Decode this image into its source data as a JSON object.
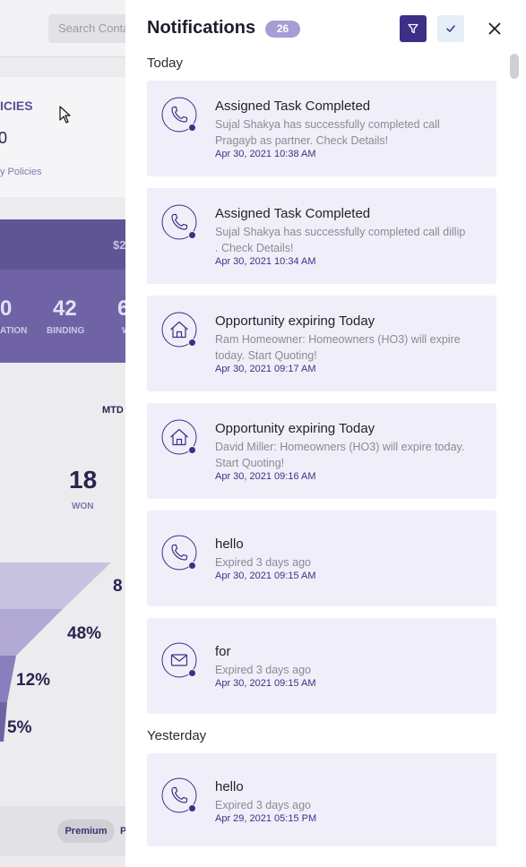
{
  "background": {
    "search_placeholder": "Search Conta",
    "policies_title": "ICIES",
    "policies_value": "0",
    "policies_link": "y Policies",
    "amount": "$2",
    "stats": [
      {
        "value": "0",
        "label": "ATION"
      },
      {
        "value": "42",
        "label": "BINDING"
      },
      {
        "value": "6",
        "label": "W"
      }
    ],
    "mtd_label": "MTD",
    "won_value": "18",
    "won_label": "WON",
    "funnel_percents": [
      "8",
      "48%",
      "12%",
      "5%"
    ],
    "pill_label": "Premium",
    "pill2_label": "P"
  },
  "panel": {
    "title": "Notifications",
    "count": "26",
    "sections": {
      "today": "Today",
      "yesterday": "Yesterday"
    },
    "notifications": [
      {
        "icon": "phone-icon",
        "title": "Assigned Task Completed",
        "desc": "Sujal Shakya has successfully completed call Pragayb as partner. Check Details!",
        "time": "Apr 30, 2021 10:38 AM"
      },
      {
        "icon": "phone-icon",
        "title": "Assigned Task Completed",
        "desc": "Sujal Shakya has successfully completed call dillip . Check Details!",
        "time": "Apr 30, 2021 10:34 AM"
      },
      {
        "icon": "home-icon",
        "title": "Opportunity expiring Today",
        "desc": "Ram Homeowner: Homeowners (HO3) will expire today. Start Quoting!",
        "time": "Apr 30, 2021 09:17 AM"
      },
      {
        "icon": "home-icon",
        "title": "Opportunity expiring Today",
        "desc": "David Miller: Homeowners (HO3) will expire today. Start Quoting!",
        "time": "Apr 30, 2021 09:16 AM"
      },
      {
        "icon": "phone-icon",
        "title": "hello",
        "desc": "Expired 3 days ago",
        "time": "Apr 30, 2021 09:15 AM"
      },
      {
        "icon": "mail-icon",
        "title": "for",
        "desc": "Expired 3 days ago",
        "time": "Apr 30, 2021 09:15 AM"
      },
      {
        "icon": "phone-icon",
        "title": "hello",
        "desc": "Expired 3 days ago",
        "time": "Apr 29, 2021 05:15 PM"
      }
    ]
  },
  "colors": {
    "accent": "#3d2f86",
    "count_badge": "#a79cd6",
    "card_bg": "#f0eff9",
    "timestamp": "#3d2f86"
  }
}
